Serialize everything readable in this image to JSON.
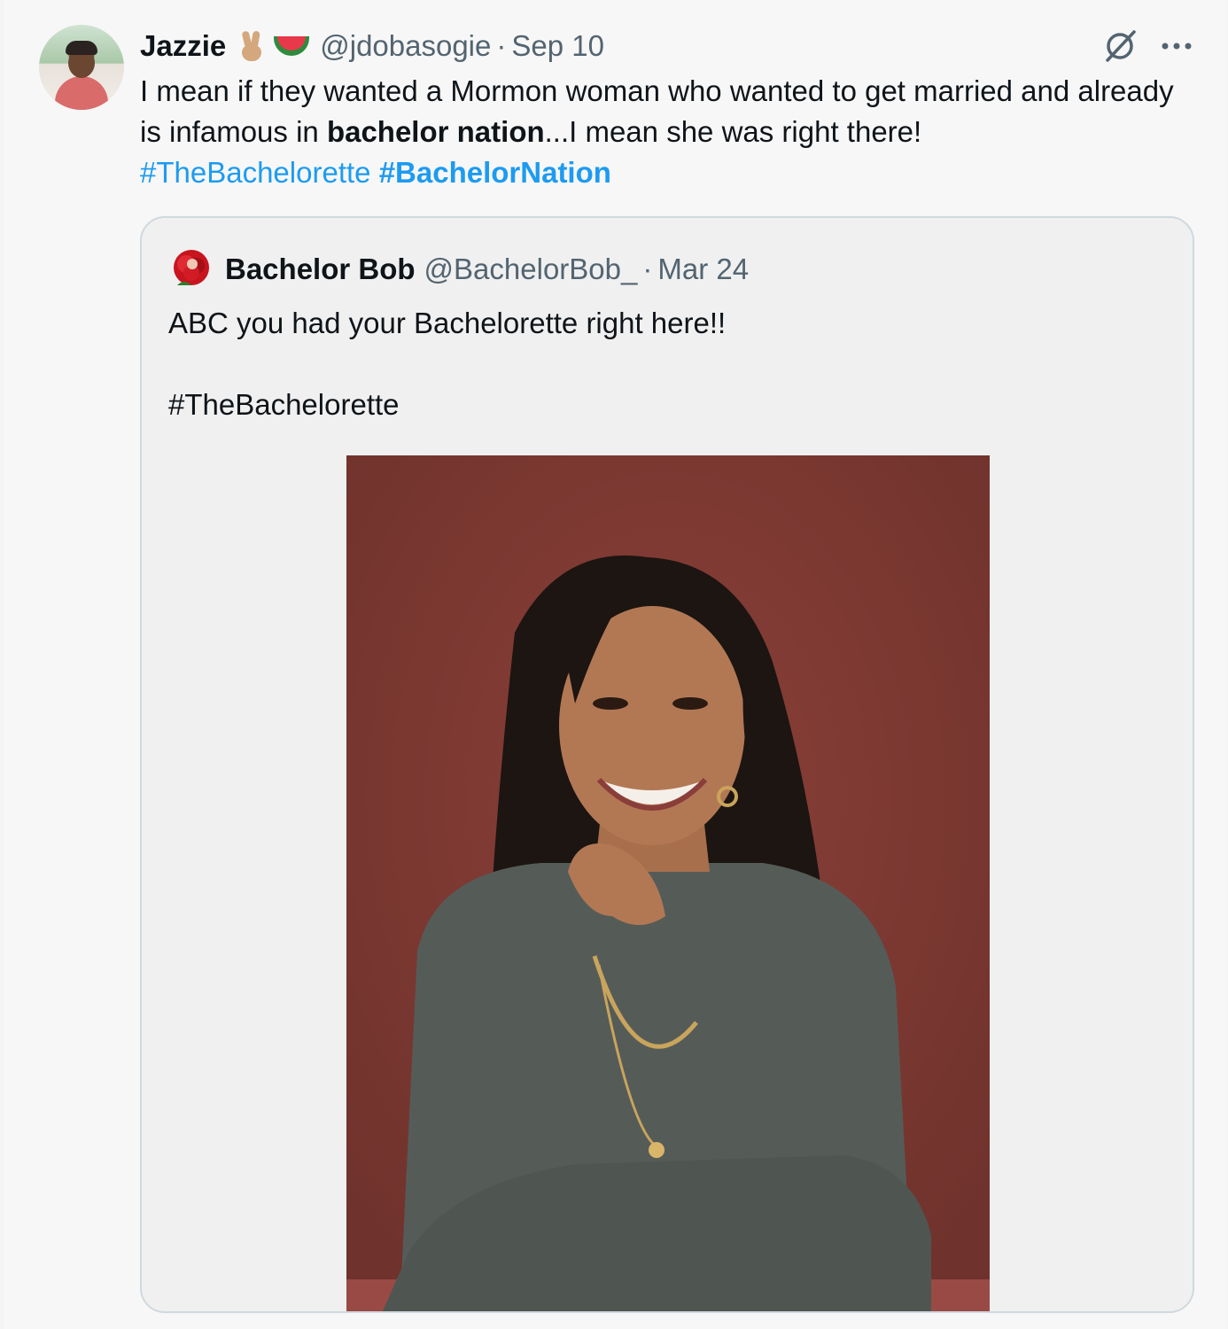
{
  "tweet": {
    "display_name": "Jazzie",
    "handle": "@jdobasogie",
    "separator": "·",
    "date": "Sep 10",
    "text_part1": "I mean if they wanted a Mormon woman who wanted to get married and already is infamous in ",
    "text_bold": "bachelor nation",
    "text_part2": "...I mean she was right there!",
    "hashtag1": "#TheBachelorette",
    "hashtag2": "#BachelorNation",
    "icons": {
      "avatar": "user-avatar",
      "emoji1": "victory-hand-emoji",
      "emoji2": "watermelon-emoji",
      "grok": "grok-icon",
      "more": "more-icon"
    }
  },
  "quote": {
    "display_name": "Bachelor Bob",
    "handle": "@BachelorBob_",
    "separator": "·",
    "date": "Mar 24",
    "text": "ABC you had your Bachelorette right here!!\n\n#TheBachelorette",
    "avatar_icon": "rose-avatar",
    "photo_icon": "portrait-photo"
  },
  "colors": {
    "link": "#1d9bf0",
    "secondary_text": "#536471",
    "photo_background": "#7e3b34"
  }
}
